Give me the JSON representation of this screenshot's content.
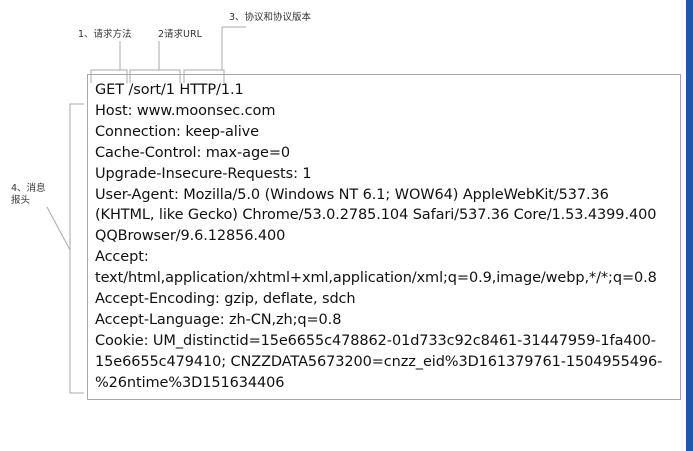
{
  "annotations": {
    "method": "1、请求方法",
    "url": "2请求URL",
    "protocol": "3、协议和协议版本",
    "headers_line1": "4、消息",
    "headers_line2": "报头"
  },
  "request_lines": [
    "GET /sort/1 HTTP/1.1",
    "Host: www.moonsec.com",
    "Connection: keep-alive",
    "Cache-Control: max-age=0",
    "Upgrade-Insecure-Requests: 1",
    "User-Agent: Mozilla/5.0 (Windows NT 6.1; WOW64) AppleWebKit/537.36",
    "(KHTML, like Gecko) Chrome/53.0.2785.104 Safari/537.36 Core/1.53.4399.400",
    "QQBrowser/9.6.12856.400",
    "Accept:",
    "text/html,application/xhtml+xml,application/xml;q=0.9,image/webp,*/*;q=0.8",
    "Accept-Encoding: gzip, deflate, sdch",
    "Accept-Language: zh-CN,zh;q=0.8",
    "Cookie: UM_distinctid=15e6655c478862-01d733c92c8461-31447959-1fa400-",
    "15e6655c479410; CNZZDATA5673200=cnzz_eid%3D161379761-1504955496-",
    "%26ntime%3D151634406"
  ],
  "colors": {
    "bracket": "#a8a8a8",
    "accent_bar": "#1f57a8"
  }
}
